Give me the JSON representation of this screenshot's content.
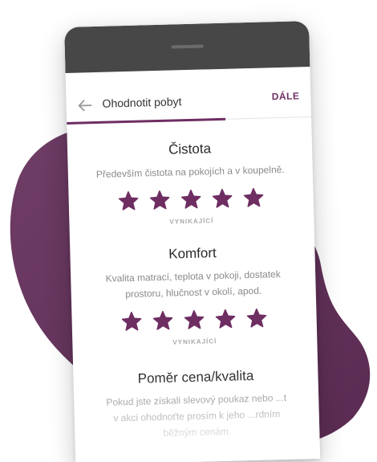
{
  "appbar": {
    "back_icon": "arrow-left-icon",
    "title": "Ohodnotit pobyt",
    "next_label": "DÁLE",
    "progress": 0.65
  },
  "colors": {
    "accent": "#6e2e62",
    "blob": "#6c3a63",
    "phone_frame": "#474747"
  },
  "categories": [
    {
      "title": "Čistota",
      "description": "Především čistota na pokojích a v koupelně.",
      "rating": 5,
      "max_rating": 5,
      "rating_label": "VYNIKAJÍCÍ"
    },
    {
      "title": "Komfort",
      "description": "Kvalita matrací, teplota v pokoji, dostatek prostoru, hlučnost v okolí, apod.",
      "rating": 5,
      "max_rating": 5,
      "rating_label": "VYNIKAJÍCÍ"
    },
    {
      "title": "Poměr cena/kvalita",
      "description": "Pokud jste získali slevový poukaz nebo ...t v akci ohodnoťte prosím k jeho ...rdním běžným cenám."
    }
  ]
}
